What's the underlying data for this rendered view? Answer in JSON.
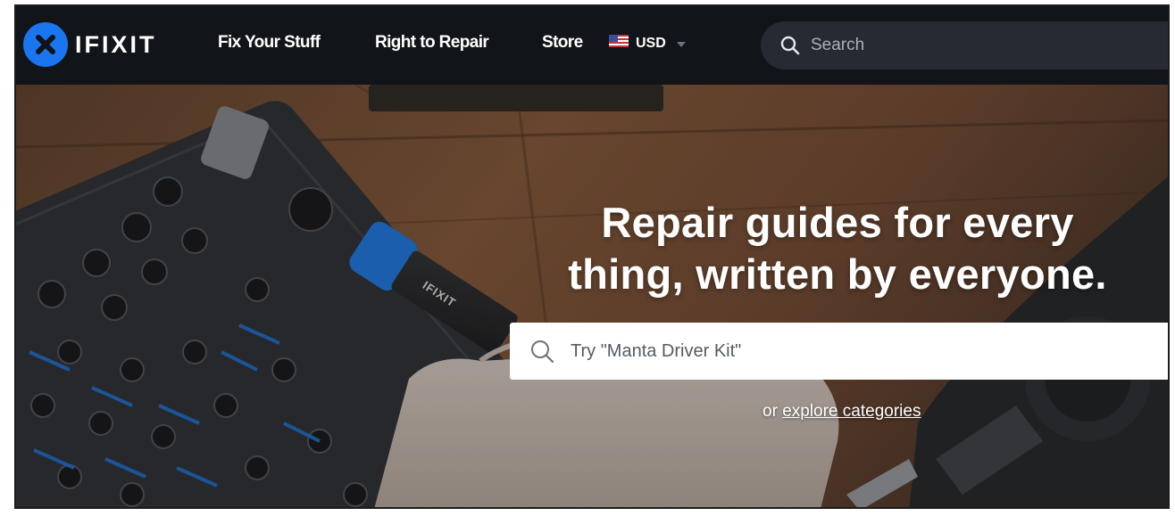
{
  "header": {
    "logo_text": "IFIXIT",
    "logo_icon": "ifixit-x-icon",
    "nav": [
      {
        "label": "Fix Your Stuff"
      },
      {
        "label": "Right to Repair"
      },
      {
        "label": "Store"
      }
    ],
    "currency": {
      "label": "USD",
      "flag_icon": "us-flag-icon"
    },
    "search": {
      "placeholder": "Search",
      "icon": "search-icon"
    }
  },
  "hero": {
    "title_line1": "Repair guides for every",
    "title_line2": "thing, written by everyone.",
    "search_placeholder": "Try \"Manta Driver Kit\"",
    "explore_prefix": "or",
    "explore_link": "explore categories"
  },
  "colors": {
    "header_bg": "#111418",
    "brand_blue": "#1976f0",
    "search_bg": "#262b33"
  }
}
